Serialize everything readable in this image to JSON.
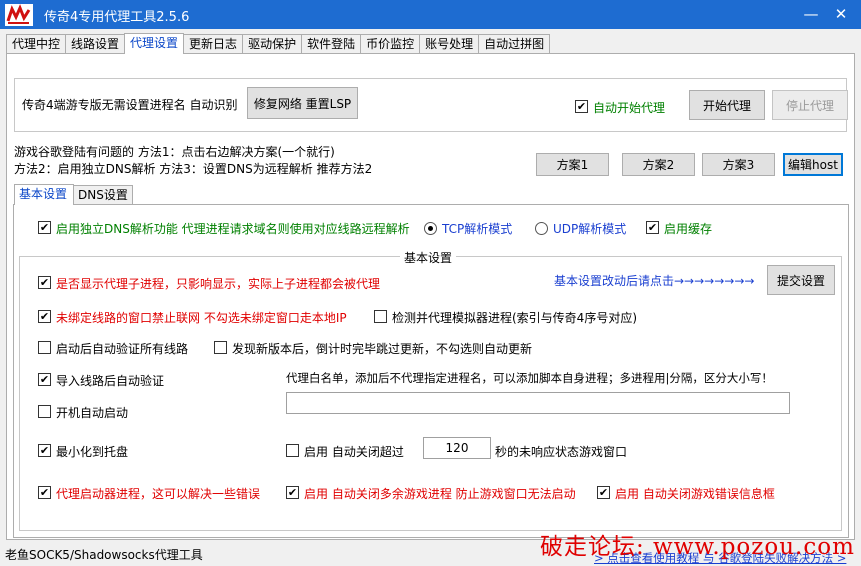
{
  "window": {
    "title": "传奇4专用代理工具2.5.6",
    "minimize": "—",
    "close": "✕"
  },
  "tabs": [
    {
      "label": "代理中控"
    },
    {
      "label": "线路设置"
    },
    {
      "label": "代理设置"
    },
    {
      "label": "更新日志"
    },
    {
      "label": "驱动保护"
    },
    {
      "label": "软件登陆"
    },
    {
      "label": "币价监控"
    },
    {
      "label": "账号处理"
    },
    {
      "label": "自动过拼图"
    }
  ],
  "top_group": {
    "desc": "传奇4端游专版无需设置进程名 自动识别",
    "repair_button": "修复网络 重置LSP",
    "auto_start_label": "自动开始代理",
    "start_button": "开始代理",
    "stop_button": "停止代理"
  },
  "google_fix": {
    "line1": "游戏谷歌登陆有问题的 方法1：点击右边解决方案(一个就行)",
    "line2": "方法2：启用独立DNS解析 方法3：设置DNS为远程解析 推荐方法2",
    "plan1": "方案1",
    "plan2": "方案2",
    "plan3": "方案3",
    "edit_host": "编辑host"
  },
  "subtabs": {
    "basic": "基本设置",
    "dns": "DNS设置"
  },
  "dns_row": {
    "enable_dns": "启用独立DNS解析功能 代理进程请求域名则使用对应线路远程解析",
    "tcp_mode": "TCP解析模式",
    "udp_mode": "UDP解析模式",
    "enable_cache": "启用缓存"
  },
  "basic": {
    "legend": "基本设置",
    "show_child": "是否显示代理子进程，只影响显示，实际上子进程都会被代理",
    "submit_hint": "基本设置改动后请点击→→→→→→→→",
    "submit_button": "提交设置",
    "block_unbound": "未绑定线路的窗口禁止联网 不勾选未绑定窗口走本地IP",
    "detect_emulator": "检测并代理模拟器进程(索引与传奇4序号对应)",
    "verify_on_start": "启动后自动验证所有线路",
    "skip_update": "发现新版本后，倒计时完毕跳过更新，不勾选则自动更新",
    "verify_on_import": "导入线路后自动验证",
    "whitelist_label": "代理白名单，添加后不代理指定进程名，可以添加脚本自身进程；多进程用|分隔，区分大小写！",
    "whitelist_value": "",
    "autostart_boot": "开机自动启动",
    "minimize_tray": "最小化到托盘",
    "auto_close_prefix": "启用 自动关闭超过",
    "auto_close_seconds": "120",
    "auto_close_suffix": "秒的未响应状态游戏窗口",
    "proxy_launcher": "代理启动器进程，这可以解决一些错误",
    "close_extra": "启用 自动关闭多余游戏进程 防止游戏窗口无法启动",
    "close_error": "启用 自动关闭游戏错误信息框"
  },
  "status": {
    "text": "老鱼SOCK5/Shadowsocks代理工具",
    "link": "> 点击查看使用教程 与 谷歌登陆失败解决方法 >",
    "watermark": "破走论坛: www.pozou.com"
  },
  "check_mark": "✔"
}
